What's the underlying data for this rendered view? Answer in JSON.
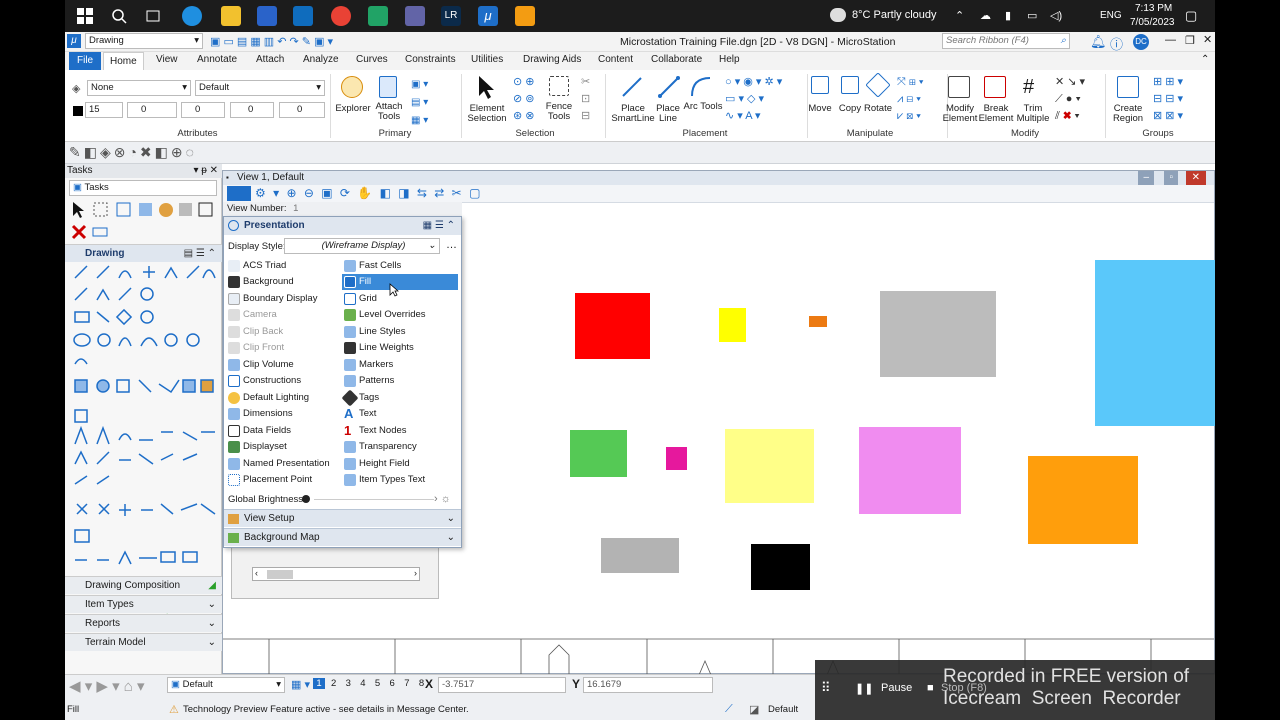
{
  "taskbar": {
    "weather": "8°C  Partly cloudy",
    "lang": "ENG",
    "time": "7:13 PM",
    "date": "7/05/2023",
    "lr_label": "LR"
  },
  "titlebar": {
    "workspace": "Drawing",
    "title": "Microstation Training File.dgn [2D - V8 DGN] - MicroStation",
    "search_placeholder": "Search Ribbon (F4)"
  },
  "ribbon_tabs": [
    "File",
    "Home",
    "View",
    "Annotate",
    "Attach",
    "Analyze",
    "Curves",
    "Constraints",
    "Utilities",
    "Drawing Aids",
    "Content",
    "Collaborate",
    "Help"
  ],
  "attributes": {
    "level": "None",
    "style": "Default",
    "weight": "15",
    "val1": "0",
    "val2": "0",
    "val3": "0",
    "val4": "0",
    "label": "Attributes"
  },
  "groups": {
    "primary": "Primary",
    "selection": "Selection",
    "placement": "Placement",
    "manipulate": "Manipulate",
    "modify": "Modify",
    "groups": "Groups"
  },
  "ribbon_buttons": {
    "explorer": "Explorer",
    "attach_tools": "Attach Tools",
    "element_selection": "Element Selection",
    "fence_tools": "Fence Tools",
    "place_smartline": "Place SmartLine",
    "place_line": "Place Line",
    "arc_tools": "Arc Tools",
    "move": "Move",
    "copy": "Copy",
    "rotate": "Rotate",
    "modify_element": "Modify Element",
    "break_element": "Break Element",
    "trim_multiple": "Trim Multiple",
    "create_region": "Create Region"
  },
  "tasks": {
    "header": "Tasks",
    "dropdown": "Tasks",
    "drawing": "Drawing",
    "drawing_composition": "Drawing Composition",
    "item_types": "Item Types",
    "reports": "Reports",
    "terrain_model": "Terrain Model"
  },
  "view": {
    "title": "View 1, Default",
    "view_number_label": "View Number:",
    "view_number": "1"
  },
  "presentation": {
    "header": "Presentation",
    "display_style_label": "Display Style:",
    "display_style": "(Wireframe Display)",
    "left_items": [
      "ACS Triad",
      "Background",
      "Boundary Display",
      "Camera",
      "Clip Back",
      "Clip Front",
      "Clip Volume",
      "Constructions",
      "Default Lighting",
      "Dimensions",
      "Data Fields",
      "Displayset",
      "Named Presentation",
      "Placement Point"
    ],
    "right_items": [
      "Fast Cells",
      "Fill",
      "Grid",
      "Level Overrides",
      "Line Styles",
      "Line Weights",
      "Markers",
      "Patterns",
      "Tags",
      "Text",
      "Text Nodes",
      "Transparency",
      "Height Field",
      "Item Types Text"
    ],
    "global_brightness": "Global Brightness:",
    "view_setup": "View Setup",
    "background_map": "Background Map"
  },
  "canvas_colors": {
    "red": "#ff0000",
    "yellow": "#ffff00",
    "orange_small": "#ec7a12",
    "gray": "#bcbcbc",
    "cyan": "#5ac8fa",
    "green": "#55c955",
    "magenta": "#e6189d",
    "lightyellow": "#ffff88",
    "pink": "#f08cf0",
    "orange": "#ff9e0c",
    "gray2": "#b3b3b3",
    "black": "#000000"
  },
  "statusbar": {
    "level": "Default",
    "views": [
      "1",
      "2",
      "3",
      "4",
      "5",
      "6",
      "7",
      "8"
    ],
    "x_label": "X",
    "x_value": "-3.7517",
    "y_label": "Y",
    "y_value": "16.1679",
    "prompt": "Fill",
    "message": "Technology Preview Feature active - see details in Message Center.",
    "level2": "Default"
  },
  "recorder": {
    "pause": "Pause",
    "stop": "Stop (F8)",
    "watermark_line1": "Recorded in FREE version of",
    "watermark_line2": "Icecream  Screen  Recorder"
  }
}
